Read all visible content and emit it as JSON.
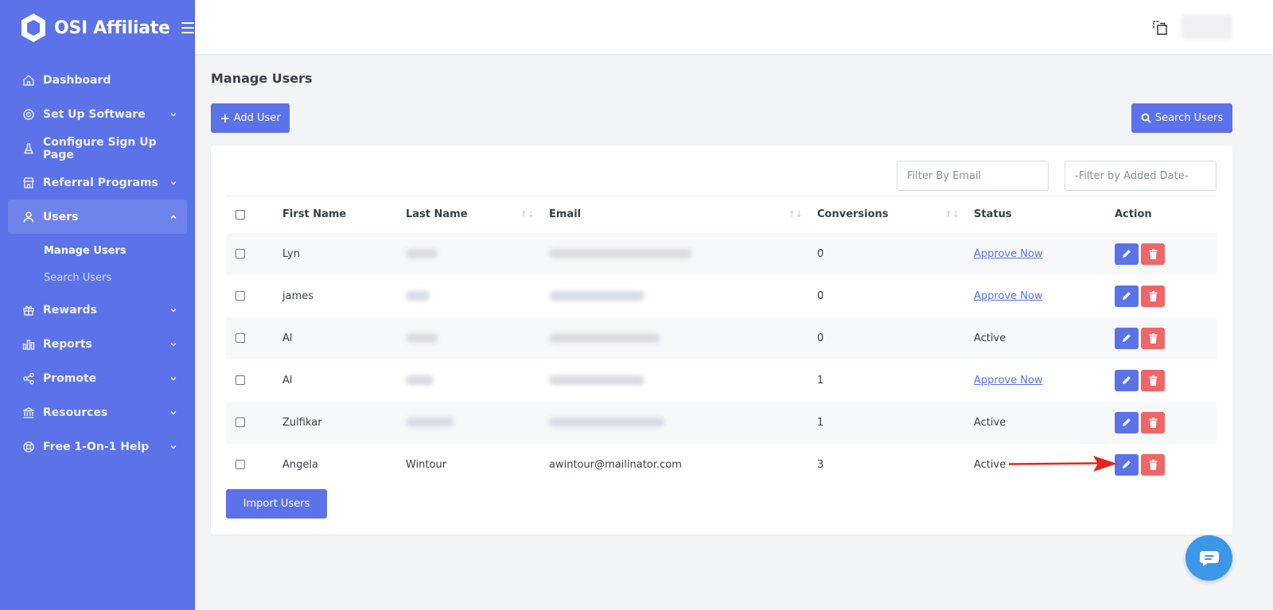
{
  "brand": {
    "name": "OSI Affiliate"
  },
  "nav": {
    "items": [
      {
        "label": "Dashboard",
        "icon": "home-icon",
        "has_chevron": false
      },
      {
        "label": "Set Up Software",
        "icon": "gear-icon",
        "has_chevron": true
      },
      {
        "label": "Configure Sign Up Page",
        "icon": "flask-icon",
        "has_chevron": false
      },
      {
        "label": "Referral Programs",
        "icon": "store-icon",
        "has_chevron": true
      },
      {
        "label": "Users",
        "icon": "user-icon",
        "has_chevron": true,
        "expanded": true
      },
      {
        "label": "Rewards",
        "icon": "gift-icon",
        "has_chevron": true
      },
      {
        "label": "Reports",
        "icon": "bar-chart-icon",
        "has_chevron": true
      },
      {
        "label": "Promote",
        "icon": "share-icon",
        "has_chevron": true
      },
      {
        "label": "Resources",
        "icon": "bank-icon",
        "has_chevron": true
      },
      {
        "label": "Free 1-On-1 Help",
        "icon": "lifebuoy-icon",
        "has_chevron": true
      }
    ],
    "users_sub": [
      {
        "label": "Manage Users",
        "active": true
      },
      {
        "label": "Search Users",
        "active": false
      }
    ]
  },
  "page": {
    "title": "Manage Users",
    "add_user_label": "Add User",
    "search_users_label": "Search Users",
    "import_users_label": "Import Users"
  },
  "filters": {
    "email_placeholder": "Filter By Email",
    "date_placeholder": "-Filter by Added Date-"
  },
  "table": {
    "headers": {
      "first_name": "First Name",
      "last_name": "Last Name",
      "email": "Email",
      "conversions": "Conversions",
      "status": "Status",
      "action": "Action"
    },
    "rows": [
      {
        "first_name": "Lyn",
        "last_name": "",
        "email": "",
        "conversions": "0",
        "status": "Approve Now",
        "status_is_link": true
      },
      {
        "first_name": "james",
        "last_name": "",
        "email": "",
        "conversions": "0",
        "status": "Approve Now",
        "status_is_link": true
      },
      {
        "first_name": "Al",
        "last_name": "",
        "email": "",
        "conversions": "0",
        "status": "Active",
        "status_is_link": false
      },
      {
        "first_name": "Al",
        "last_name": "",
        "email": "",
        "conversions": "1",
        "status": "Approve Now",
        "status_is_link": true
      },
      {
        "first_name": "Zulfikar",
        "last_name": "",
        "email": "",
        "conversions": "1",
        "status": "Active",
        "status_is_link": false
      },
      {
        "first_name": "Angela",
        "last_name": "Wintour",
        "email": "awintour@mailinator.com",
        "conversions": "3",
        "status": "Active",
        "status_is_link": false
      }
    ]
  },
  "colors": {
    "sidebar": "#5b72e8",
    "primary": "#5b72e8",
    "danger": "#ef6666",
    "chat": "#3b97e8",
    "annotation_arrow": "#e8241c"
  }
}
